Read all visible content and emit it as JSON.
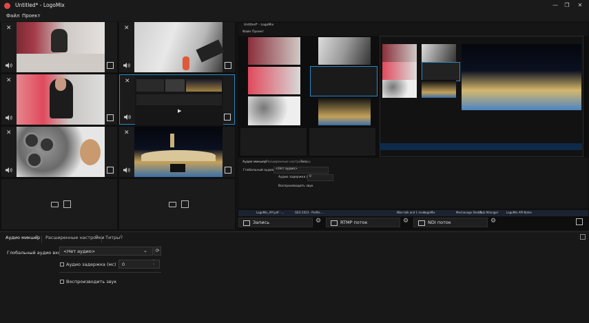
{
  "window": {
    "title": "Untitled* - LogoMix"
  },
  "menu": [
    "Файл",
    "Проект"
  ],
  "preview": {
    "title": "Untitled* - LogoMix",
    "menu": [
      "Файл",
      "Проект"
    ],
    "tabs": [
      "Аудио микшер",
      "Расширенные настройки",
      "Титры"
    ],
    "global_audio_label": "Глобальный аудио вход",
    "audio_value": "<Нет аудио>",
    "delay_label": "Аудио задержка (мс)",
    "delay_value": "0",
    "play_label": "Воспроизводить звук",
    "taskbar": [
      "LogoMix_API.pdf - ...",
      "GEO 2023 - Profile ...",
      "Nike talk and 1 more",
      "LogoMix",
      "Mechanage Shebit...",
      "Task Manager",
      "LogoMix API Notes"
    ]
  },
  "record_bar": {
    "record": "Запись",
    "rtmp": "RTMP поток",
    "ndi": "NDI поток"
  },
  "bottom_panel": {
    "tabs": [
      "Аудио микшер",
      "Расширенные настройки",
      "Титры"
    ],
    "global_audio_label": "Глобальный аудио вход",
    "audio_select": "<Нет аудио>",
    "delay_label": "Аудио задержка (мс)",
    "delay_value": "0",
    "play_sound_label": "Воспроизводить звук"
  },
  "colors": {
    "accent": "#2a8ac8",
    "logo": "#e04848"
  }
}
